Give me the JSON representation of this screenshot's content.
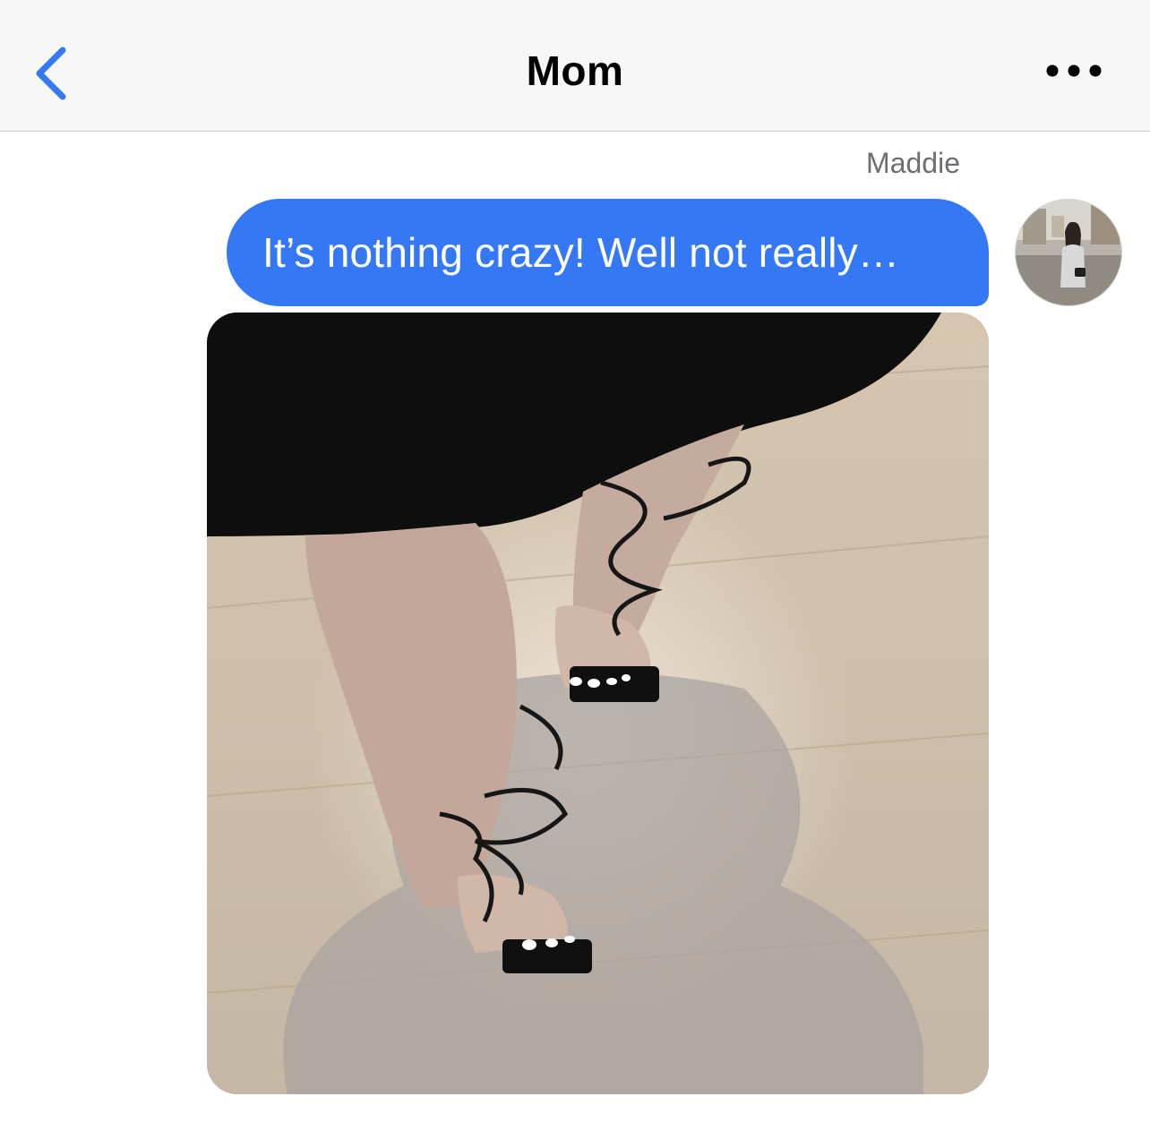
{
  "header": {
    "title": "Mom",
    "back_icon": "chevron-left-icon",
    "more_icon": "ellipsis-icon",
    "accent_color": "#3478f6"
  },
  "conversation": {
    "sender_name": "Maddie",
    "messages": [
      {
        "type": "text",
        "text": "It’s nothing crazy! Well not really…",
        "bubble_color": "#3478f6"
      },
      {
        "type": "image"
      }
    ]
  }
}
